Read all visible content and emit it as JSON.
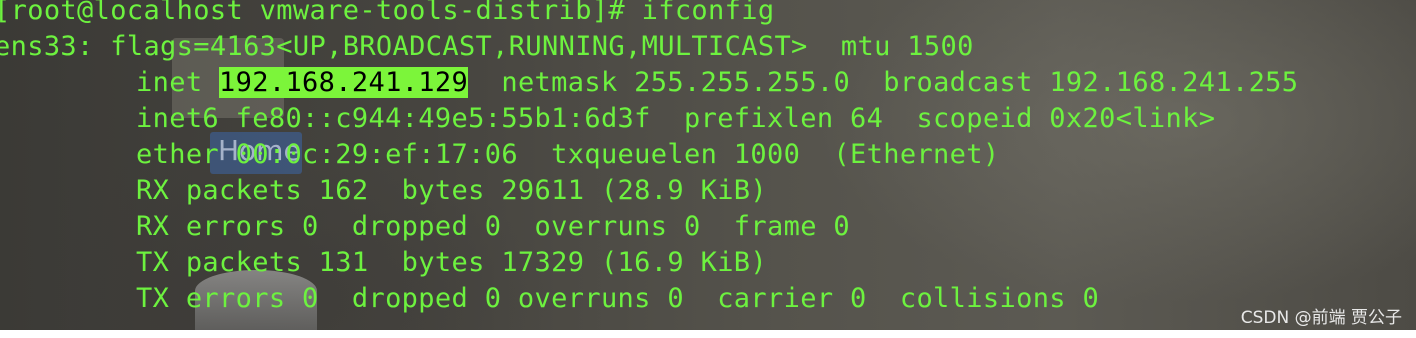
{
  "terminal": {
    "prompt_line": "[root@localhost vmware-tools-distrib]# ifconfig",
    "iface_line": "ens33: flags=4163<UP,BROADCAST,RUNNING,MULTICAST>  mtu 1500",
    "inet": {
      "label": "inet ",
      "address": "192.168.241.129",
      "rest": "  netmask 255.255.255.0  broadcast 192.168.241.255"
    },
    "inet6_line": "inet6 fe80::c944:49e5:55b1:6d3f  prefixlen 64  scopeid 0x20<link>",
    "ether_line": "ether 00:0c:29:ef:17:06  txqueuelen 1000  (Ethernet)",
    "rx_packets_line": "RX packets 162  bytes 29611 (28.9 KiB)",
    "rx_errors_line": "RX errors 0  dropped 0  overruns 0  frame 0",
    "tx_packets_line": "TX packets 131  bytes 17329 (16.9 KiB)",
    "tx_errors_line": "TX errors 0  dropped 0 overruns 0  carrier 0  collisions 0"
  },
  "desktop": {
    "home_label": "Home"
  },
  "watermark": "CSDN @前端 贾公子",
  "colors": {
    "terminal_text": "#6df23f",
    "highlight_bg": "#7cf53a"
  }
}
